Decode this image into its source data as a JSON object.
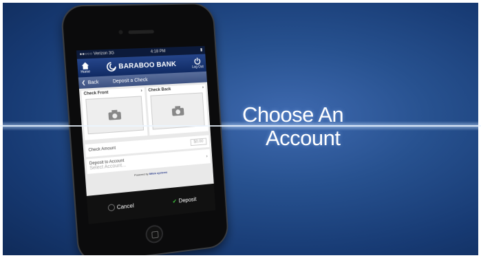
{
  "headline": {
    "line1": "Choose An",
    "line2": "Account"
  },
  "status": {
    "carrier": "●●○○○ Verizon  3G",
    "time": "4:18 PM"
  },
  "appbar": {
    "home_label": "Home",
    "brand": "BARABOO BANK",
    "logout_label": "Log Out"
  },
  "nav": {
    "back_label": "Back",
    "title": "Deposit a Check"
  },
  "checks": {
    "front_label": "Check Front",
    "back_label": "Check Back"
  },
  "form": {
    "amount_label": "Check Amount",
    "amount_placeholder": "$0.00",
    "deposit_label": "Deposit to Account",
    "account_placeholder": "Select Account..."
  },
  "powered": {
    "prefix": "Powered by",
    "vendor": "Mitek systems"
  },
  "actions": {
    "cancel_label": "Cancel",
    "deposit_label": "Deposit"
  },
  "colors": {
    "accent": "#2d3e8c",
    "background": "#27518f",
    "deposit_check": "#3cbf3c"
  }
}
